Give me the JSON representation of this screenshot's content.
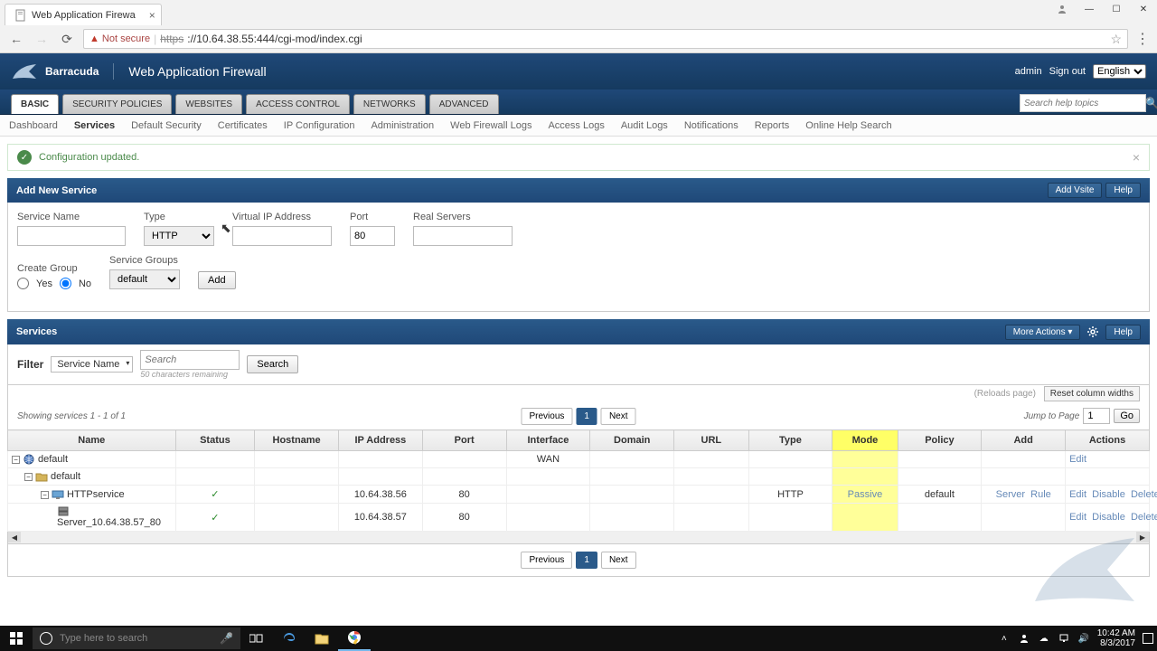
{
  "browser": {
    "tab_title": "Web Application Firewa",
    "not_secure": "Not secure",
    "url_proto": "https",
    "url_rest": "://10.64.38.55:444/cgi-mod/index.cgi"
  },
  "header": {
    "brand": "Barracuda",
    "product": "Web Application Firewall",
    "user": "admin",
    "signout": "Sign out",
    "language": "English"
  },
  "primary_nav": [
    "BASIC",
    "SECURITY POLICIES",
    "WEBSITES",
    "ACCESS CONTROL",
    "NETWORKS",
    "ADVANCED"
  ],
  "primary_nav_active": 0,
  "search_help_placeholder": "Search help topics",
  "secondary_nav": [
    "Dashboard",
    "Services",
    "Default Security",
    "Certificates",
    "IP Configuration",
    "Administration",
    "Web Firewall Logs",
    "Access Logs",
    "Audit Logs",
    "Notifications",
    "Reports",
    "Online Help Search"
  ],
  "secondary_nav_active": 1,
  "alert_text": "Configuration updated.",
  "add_service": {
    "title": "Add New Service",
    "add_vsite": "Add Vsite",
    "help": "Help",
    "labels": {
      "service_name": "Service Name",
      "type": "Type",
      "vip": "Virtual IP Address",
      "port": "Port",
      "real_servers": "Real Servers",
      "create_group": "Create Group",
      "yes": "Yes",
      "no": "No",
      "service_groups": "Service Groups",
      "add": "Add"
    },
    "type_value": "HTTP",
    "port_value": "80",
    "service_group_value": "default"
  },
  "services_panel": {
    "title": "Services",
    "more_actions": "More Actions",
    "help": "Help",
    "filter_label": "Filter",
    "filter_field": "Service Name",
    "search_placeholder": "Search",
    "search_btn": "Search",
    "chars_remaining": "50 characters remaining",
    "reloads": "(Reloads page)",
    "reset_cols": "Reset column widths",
    "showing": "Showing services 1 - 1 of 1",
    "previous": "Previous",
    "next": "Next",
    "page": "1",
    "jump_label": "Jump to Page",
    "jump_value": "1",
    "go": "Go",
    "columns": [
      "Name",
      "Status",
      "Hostname",
      "IP Address",
      "Port",
      "Interface",
      "Domain",
      "URL",
      "Type",
      "Mode",
      "Policy",
      "Add",
      "Actions"
    ],
    "rows": {
      "vsite": {
        "name": "default",
        "interface": "WAN",
        "edit": "Edit"
      },
      "group": {
        "name": "default"
      },
      "service": {
        "name": "HTTPservice",
        "ip": "10.64.38.56",
        "port": "80",
        "type": "HTTP",
        "mode": "Passive",
        "policy": "default",
        "add_server": "Server",
        "add_rule": "Rule",
        "edit": "Edit",
        "disable": "Disable",
        "delete": "Delete"
      },
      "server": {
        "name": "Server_10.64.38.57_80",
        "ip": "10.64.38.57",
        "port": "80",
        "edit": "Edit",
        "disable": "Disable",
        "delete": "Delete"
      }
    }
  },
  "taskbar": {
    "search_placeholder": "Type here to search",
    "time": "10:42 AM",
    "date": "8/3/2017"
  }
}
